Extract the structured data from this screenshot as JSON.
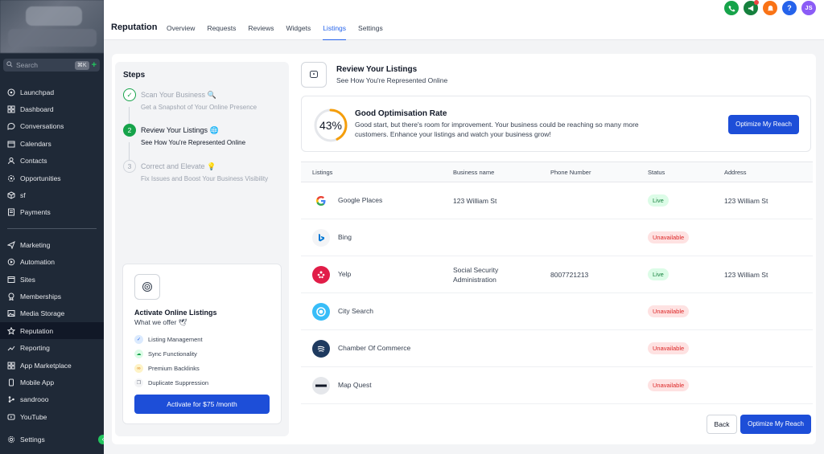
{
  "sidebar": {
    "search_placeholder": "Search",
    "search_shortcut": "⌘K",
    "items_top": [
      {
        "label": "Launchpad",
        "icon": "launchpad-icon"
      },
      {
        "label": "Dashboard",
        "icon": "dashboard-icon"
      },
      {
        "label": "Conversations",
        "icon": "chat-icon"
      },
      {
        "label": "Calendars",
        "icon": "calendar-icon"
      },
      {
        "label": "Contacts",
        "icon": "contacts-icon"
      },
      {
        "label": "Opportunities",
        "icon": "opportunities-icon"
      },
      {
        "label": "sf",
        "icon": "cube-icon"
      },
      {
        "label": "Payments",
        "icon": "payments-icon"
      }
    ],
    "items_bottom": [
      {
        "label": "Marketing",
        "icon": "send-icon"
      },
      {
        "label": "Automation",
        "icon": "automation-icon"
      },
      {
        "label": "Sites",
        "icon": "sites-icon"
      },
      {
        "label": "Memberships",
        "icon": "memberships-icon"
      },
      {
        "label": "Media Storage",
        "icon": "media-icon"
      },
      {
        "label": "Reputation",
        "icon": "star-icon"
      },
      {
        "label": "Reporting",
        "icon": "chart-icon"
      },
      {
        "label": "App Marketplace",
        "icon": "apps-icon"
      },
      {
        "label": "Mobile App",
        "icon": "mobile-icon"
      },
      {
        "label": "sandrooo",
        "icon": "node-icon"
      },
      {
        "label": "YouTube",
        "icon": "youtube-icon"
      }
    ],
    "settings_label": "Settings"
  },
  "header": {
    "title": "Reputation",
    "tabs": [
      "Overview",
      "Requests",
      "Reviews",
      "Widgets",
      "Listings",
      "Settings"
    ],
    "active_tab": "Listings",
    "avatar_initials": "JS",
    "help_label": "?"
  },
  "steps": {
    "heading": "Steps",
    "items": [
      {
        "number": "✓",
        "title": "Scan Your Business 🔍",
        "subtitle": "Get a Snapshot of Your Online Presence",
        "state": "done"
      },
      {
        "number": "2",
        "title": "Review Your Listings 🌐",
        "subtitle": "See How You're Represented Online",
        "state": "active"
      },
      {
        "number": "3",
        "title": "Correct and Elevate 💡",
        "subtitle": "Fix Issues and Boost Your Business Visibility",
        "state": "pending"
      }
    ]
  },
  "promo": {
    "title": "Activate Online Listings",
    "subtitle": "What we offer 🕊",
    "features": [
      "Listing Management",
      "Sync Functionality",
      "Premium Backlinks",
      "Duplicate Suppression"
    ],
    "button_label": "Activate for $75 /month"
  },
  "review": {
    "title": "Review Your Listings",
    "subtitle": "See How You're Represented Online"
  },
  "rate": {
    "percent": 43,
    "percent_label": "43%",
    "title": "Good Optimisation Rate",
    "text": "Good start, but there's room for improvement. Your business could be reaching so many more customers. Enhance your listings and watch your business grow!",
    "button_label": "Optimize My Reach"
  },
  "table": {
    "headers": [
      "Listings",
      "Business name",
      "Phone Number",
      "Status",
      "Address"
    ],
    "rows": [
      {
        "name": "Google Places",
        "business": "123 William St",
        "phone": "",
        "status": "Live",
        "address": "123 William St"
      },
      {
        "name": "Bing",
        "business": "",
        "phone": "",
        "status": "Unavailable",
        "address": ""
      },
      {
        "name": "Yelp",
        "business": "Social Security Administration",
        "phone": "8007721213",
        "status": "Live",
        "address": "123 William St"
      },
      {
        "name": "City Search",
        "business": "",
        "phone": "",
        "status": "Unavailable",
        "address": ""
      },
      {
        "name": "Chamber Of Commerce",
        "business": "",
        "phone": "",
        "status": "Unavailable",
        "address": ""
      },
      {
        "name": "Map Quest",
        "business": "",
        "phone": "",
        "status": "Unavailable",
        "address": ""
      }
    ]
  },
  "footer": {
    "back_label": "Back",
    "optimize_label": "Optimize My Reach"
  },
  "colors": {
    "accent": "#1d4ed8",
    "sidebar_bg": "#1f2937",
    "live": "#15803d",
    "unavailable": "#dc2626",
    "gauge": "#f59e0b"
  }
}
